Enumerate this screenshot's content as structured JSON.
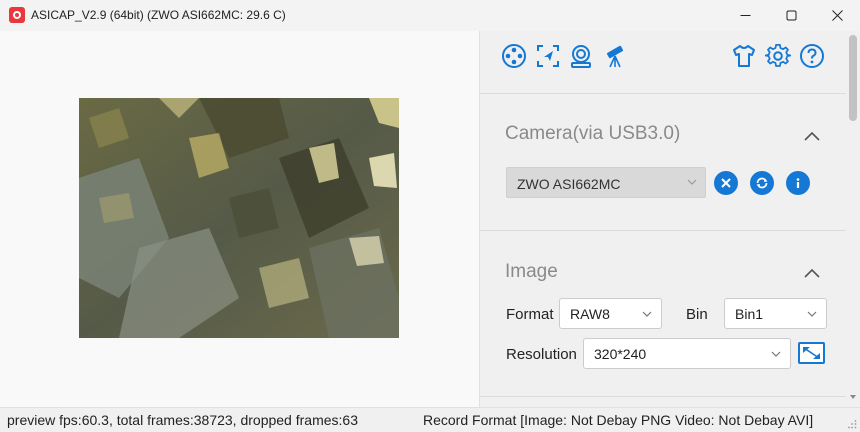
{
  "window": {
    "title": "ASICAP_V2.9 (64bit) (ZWO ASI662MC: 29.6 C)",
    "minimize_icon": "minimize-icon",
    "maximize_icon": "maximize-icon",
    "close_icon": "close-icon"
  },
  "toolbar": {
    "left_icons": [
      "capture-settings-icon",
      "roi-cursor-icon",
      "camera-cooler-icon",
      "telescope-icon"
    ],
    "right_icons": [
      "theme-tshirt-icon",
      "settings-gear-icon",
      "help-icon"
    ],
    "accent_color": "#1478d4"
  },
  "camera_section": {
    "title": "Camera(via USB3.0)",
    "selected_camera": "ZWO ASI662MC",
    "buttons": [
      "disconnect-icon",
      "refresh-icon",
      "info-icon"
    ]
  },
  "image_section": {
    "title": "Image",
    "format_label": "Format",
    "format_value": "RAW8",
    "bin_label": "Bin",
    "bin_value": "Bin1",
    "resolution_label": "Resolution",
    "resolution_value": "320*240"
  },
  "status": {
    "left": "preview fps:60.3, total frames:38723, dropped frames:63",
    "right": "Record Format [Image: Not Debay PNG Video: Not Debay AVI]"
  }
}
